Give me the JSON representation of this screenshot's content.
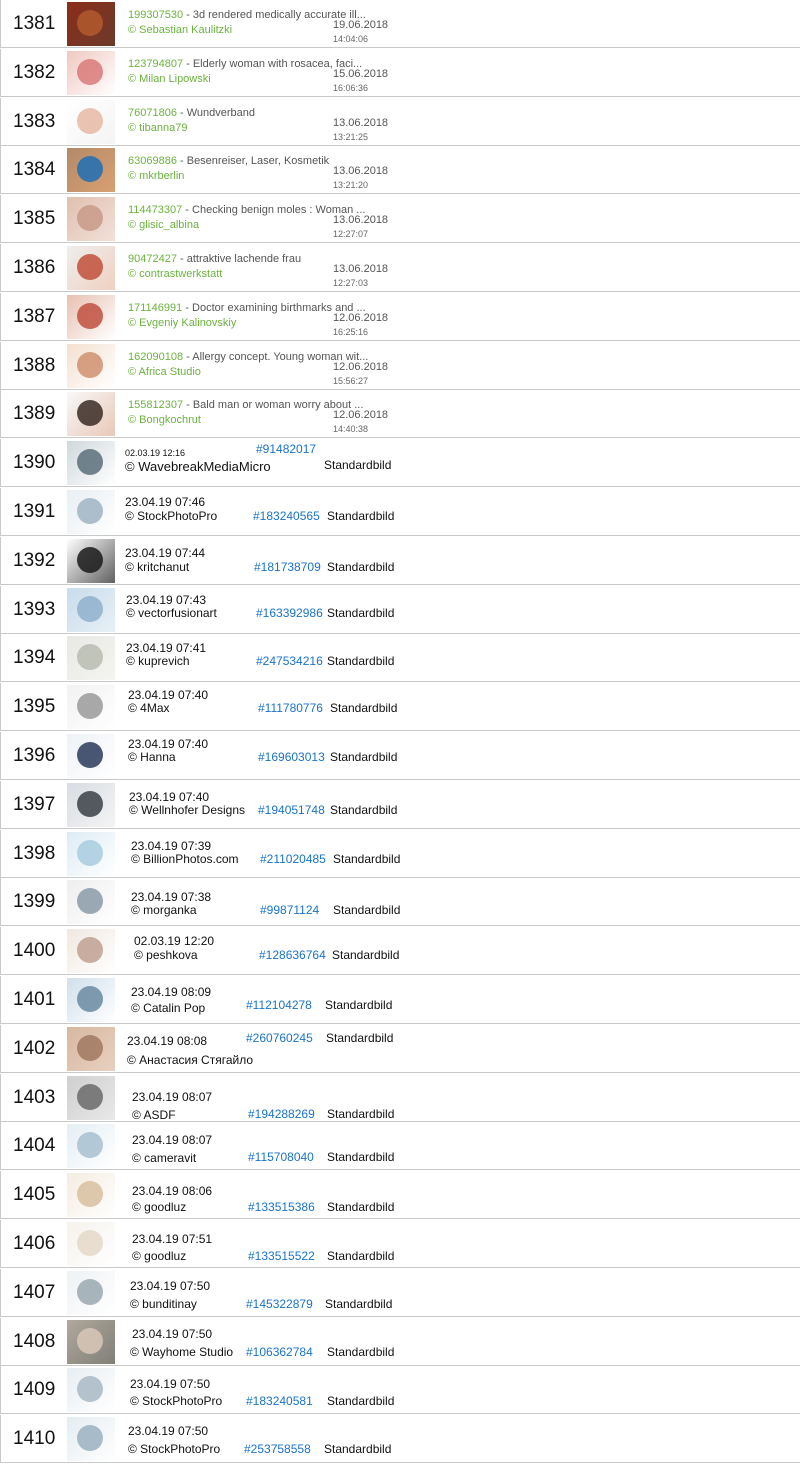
{
  "rows": [
    {
      "n": "1381",
      "kind": "old",
      "id": "199307530",
      "title": " - 3d rendered medically accurate ill...",
      "author": "© Sebastian Kaulitzki",
      "date": "19.06.2018",
      "time": "14:04:06",
      "thumb": [
        "#8b2d1a",
        "#b35a2e",
        "#6b3a2a"
      ]
    },
    {
      "n": "1382",
      "kind": "old",
      "id": "123794807",
      "title": " - Elderly woman with rosacea, faci...",
      "author": "© Milan Lipowski",
      "date": "15.06.2018",
      "time": "16:06:36",
      "thumb": [
        "#f0c8c0",
        "#d97a7a",
        "#ffffff"
      ]
    },
    {
      "n": "1383",
      "kind": "old",
      "id": "76071806",
      "title": " - Wundverband",
      "author": "© tibanna79",
      "date": "13.06.2018",
      "time": "13:21:25",
      "thumb": [
        "#ffffff",
        "#e8b8a6",
        "#f4f4f4"
      ]
    },
    {
      "n": "1384",
      "kind": "old",
      "id": "63069886",
      "title": " - Besenreiser, Laser, Kosmetik",
      "author": "© mkrberlin",
      "date": "13.06.2018",
      "time": "13:21:20",
      "thumb": [
        "#b38a6a",
        "#1e6fb5",
        "#d9a070"
      ]
    },
    {
      "n": "1385",
      "kind": "old",
      "id": "114473307",
      "title": " - Checking benign moles : Woman ...",
      "author": "© glisic_albina",
      "date": "13.06.2018",
      "time": "12:27:07",
      "thumb": [
        "#e0c0b0",
        "#c89a88",
        "#f2e0d8"
      ]
    },
    {
      "n": "1386",
      "kind": "old",
      "id": "90472427",
      "title": " - attraktive lachende frau",
      "author": "© contrastwerkstatt",
      "date": "13.06.2018",
      "time": "12:27:03",
      "thumb": [
        "#eeeeee",
        "#c0503a",
        "#f0d0c0"
      ]
    },
    {
      "n": "1387",
      "kind": "old",
      "id": "171146991",
      "title": " - Doctor examining birthmarks and ...",
      "author": "© Evgeniy Kalinovskiy",
      "date": "12.06.2018",
      "time": "16:25:16",
      "thumb": [
        "#e8c0b0",
        "#c05040",
        "#ffffff"
      ]
    },
    {
      "n": "1388",
      "kind": "old",
      "id": "162090108",
      "title": " - Allergy concept. Young woman wit...",
      "author": "© Africa Studio",
      "date": "12.06.2018",
      "time": "15:56:27",
      "thumb": [
        "#f4e0d0",
        "#d09070",
        "#ffffff"
      ]
    },
    {
      "n": "1389",
      "kind": "old",
      "id": "155812307",
      "title": " - Bald man or woman worry about ...",
      "author": "© Bongkochrut",
      "date": "12.06.2018",
      "time": "14:40:38",
      "thumb": [
        "#f8f8f8",
        "#3a2a24",
        "#e8c8b8"
      ]
    },
    {
      "n": "1390",
      "kind": "new",
      "date": "02.03.19  12:16",
      "author": "©  WavebreakMediaMicro",
      "id": "#91482017",
      "type": "Standardbild",
      "thumb": [
        "#cfd8dc",
        "#5a6e7a",
        "#ffffff"
      ]
    },
    {
      "n": "1391",
      "kind": "new",
      "date": "23.04.19 07:46",
      "author": "© StockPhotoPro",
      "id": "#183240565",
      "type": "Standardbild",
      "thumb": [
        "#e8eef2",
        "#9fb4c4",
        "#ffffff"
      ]
    },
    {
      "n": "1392",
      "kind": "new",
      "date": "23.04.19 07:44",
      "author": "© kritchanut",
      "id": "#181738709",
      "type": "Standardbild",
      "thumb": [
        "#ffffff",
        "#1a1a1a",
        "#606060"
      ]
    },
    {
      "n": "1393",
      "kind": "new",
      "date": "23.04.19 07:43",
      "author": "© vectorfusionart",
      "id": "#163392986",
      "type": "Standardbild",
      "thumb": [
        "#c8dcec",
        "#8fb0cc",
        "#e8f0f6"
      ]
    },
    {
      "n": "1394",
      "kind": "new",
      "date": "23.04.19 07:41",
      "author": "© kuprevich",
      "id": "#247534216",
      "type": "Standardbild",
      "thumb": [
        "#e8e8e4",
        "#b8bcb0",
        "#f4f4f0"
      ]
    },
    {
      "n": "1395",
      "kind": "new",
      "date": "23.04.19 07:40",
      "author": "© 4Max",
      "id": "#111780776",
      "type": "Standardbild",
      "thumb": [
        "#f2f2f2",
        "#9a9a9a",
        "#ffffff"
      ]
    },
    {
      "n": "1396",
      "kind": "new",
      "date": "23.04.19 07:40",
      "author": "© Hanna",
      "id": "#169603013",
      "type": "Standardbild",
      "thumb": [
        "#eef2f6",
        "#2a3a5a",
        "#ffffff"
      ]
    },
    {
      "n": "1397",
      "kind": "new",
      "date": "23.04.19 07:40",
      "author": "© Wellnhofer Designs",
      "id": "#194051748",
      "type": "Standardbild",
      "thumb": [
        "#d8dde2",
        "#3a4048",
        "#f4f4f4"
      ]
    },
    {
      "n": "1398",
      "kind": "new",
      "date": "23.04.19 07:39",
      "author": "© BillionPhotos.com",
      "id": "#211020485",
      "type": "Standardbild",
      "thumb": [
        "#dcecf4",
        "#a8cce0",
        "#ffffff"
      ]
    },
    {
      "n": "1399",
      "kind": "new",
      "date": "23.04.19 07:38",
      "author": "© morganka",
      "id": "#99871124",
      "type": "Standardbild",
      "thumb": [
        "#eeeeee",
        "#8a9aa8",
        "#ffffff"
      ]
    },
    {
      "n": "1400",
      "kind": "new",
      "date": "02.03.19 12:20",
      "author": "© peshkova",
      "id": "#128636764",
      "type": "Standardbild",
      "thumb": [
        "#f0e8e0",
        "#c0a090",
        "#ffffff"
      ]
    },
    {
      "n": "1401",
      "kind": "new",
      "date": "23.04.19 08:09",
      "author": "© Catalin Pop",
      "id": "#112104278",
      "type": "Standardbild",
      "thumb": [
        "#cfe0ec",
        "#6a8aa0",
        "#ffffff"
      ]
    },
    {
      "n": "1402",
      "kind": "new",
      "date": "23.04.19 08:08",
      "author": "© Анастасия Стягайло",
      "id": "#260760245",
      "type": "Standardbild",
      "thumb": [
        "#d8b8a0",
        "#a07860",
        "#e8d0c0"
      ]
    },
    {
      "n": "1403",
      "kind": "new",
      "date": "23.04.19 08:07",
      "author": "© ASDF",
      "id": "#194288269",
      "type": "Standardbild",
      "thumb": [
        "#cfcfcf",
        "#6a6a6a",
        "#e8e8e8"
      ]
    },
    {
      "n": "1404",
      "kind": "new",
      "date": "23.04.19 08:07",
      "author": "© cameravit",
      "id": "#115708040",
      "type": "Standardbild",
      "thumb": [
        "#e4eef4",
        "#a8c0d0",
        "#ffffff"
      ]
    },
    {
      "n": "1405",
      "kind": "new",
      "date": "23.04.19 08:06",
      "author": "© goodluz",
      "id": "#133515386",
      "type": "Standardbild",
      "thumb": [
        "#f4ece0",
        "#d8c0a0",
        "#ffffff"
      ]
    },
    {
      "n": "1406",
      "kind": "new",
      "date": "23.04.19 07:51",
      "author": "© goodluz",
      "id": "#133515522",
      "type": "Standardbild",
      "thumb": [
        "#f6f2ec",
        "#e4d8c8",
        "#ffffff"
      ]
    },
    {
      "n": "1407",
      "kind": "new",
      "date": "23.04.19 07:50",
      "author": "© bunditinay",
      "id": "#145322879",
      "type": "Standardbild",
      "thumb": [
        "#eef2f4",
        "#9aa8b0",
        "#ffffff"
      ]
    },
    {
      "n": "1408",
      "kind": "new",
      "date": "23.04.19 07:50",
      "author": "© Wayhome Studio",
      "id": "#106362784",
      "type": "Standardbild",
      "thumb": [
        "#b0a89c",
        "#d8c8b8",
        "#808078"
      ]
    },
    {
      "n": "1409",
      "kind": "new",
      "date": "23.04.19 07:50",
      "author": "© StockPhotoPro",
      "id": "#183240581",
      "type": "Standardbild",
      "thumb": [
        "#e8eef2",
        "#a8b8c4",
        "#ffffff"
      ]
    },
    {
      "n": "1410",
      "kind": "new",
      "date": "23.04.19 07:50",
      "author": "© StockPhotoPro",
      "id": "#253758558",
      "type": "Standardbild",
      "thumb": [
        "#e4ecf0",
        "#9ab0c0",
        "#ffffff"
      ]
    }
  ]
}
